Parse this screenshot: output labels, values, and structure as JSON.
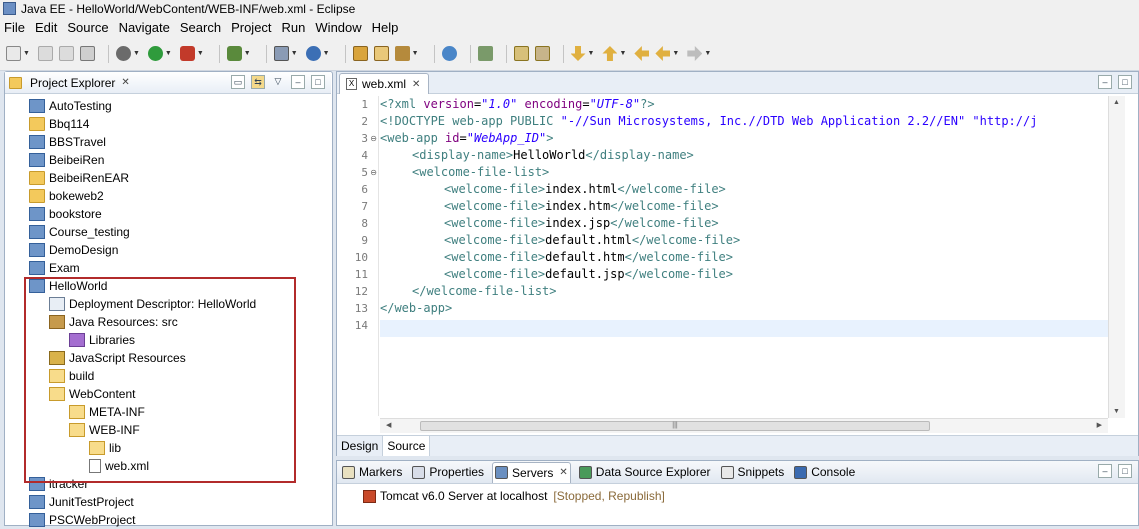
{
  "window": {
    "title": "Java EE - HelloWorld/WebContent/WEB-INF/web.xml - Eclipse"
  },
  "menu": [
    "File",
    "Edit",
    "Source",
    "Navigate",
    "Search",
    "Project",
    "Run",
    "Window",
    "Help"
  ],
  "explorer": {
    "title": "Project Explorer",
    "items": [
      {
        "label": "AutoTesting",
        "icon": "web-project-icon"
      },
      {
        "label": "Bbq114",
        "icon": "project-icon"
      },
      {
        "label": "BBSTravel",
        "icon": "web-project-icon"
      },
      {
        "label": "BeibeiRen",
        "icon": "web-project-icon"
      },
      {
        "label": "BeibeiRenEAR",
        "icon": "project-icon"
      },
      {
        "label": "bokeweb2",
        "icon": "project-icon"
      },
      {
        "label": "bookstore",
        "icon": "web-project-icon"
      },
      {
        "label": "Course_testing",
        "icon": "web-project-icon"
      },
      {
        "label": "DemoDesign",
        "icon": "web-project-icon"
      },
      {
        "label": "Exam",
        "icon": "web-project-icon"
      },
      {
        "label": "HelloWorld",
        "icon": "web-project-icon"
      },
      {
        "label": "Deployment Descriptor: HelloWorld",
        "icon": "deployment-descriptor-icon"
      },
      {
        "label": "Java Resources: src",
        "icon": "java-resources-icon"
      },
      {
        "label": "Libraries",
        "icon": "libraries-icon"
      },
      {
        "label": "JavaScript Resources",
        "icon": "javascript-resources-icon"
      },
      {
        "label": "build",
        "icon": "folder-icon"
      },
      {
        "label": "WebContent",
        "icon": "folder-icon"
      },
      {
        "label": "META-INF",
        "icon": "folder-icon"
      },
      {
        "label": "WEB-INF",
        "icon": "folder-icon"
      },
      {
        "label": "lib",
        "icon": "folder-icon"
      },
      {
        "label": "web.xml",
        "icon": "xml-file-icon"
      },
      {
        "label": "itracker",
        "icon": "web-project-icon"
      },
      {
        "label": "JunitTestProject",
        "icon": "web-project-icon"
      },
      {
        "label": "PSCWebProject",
        "icon": "web-project-icon"
      }
    ]
  },
  "editor": {
    "tab_label": "web.xml",
    "line_numbers": [
      "1",
      "2",
      "3",
      "4",
      "5",
      "6",
      "7",
      "8",
      "9",
      "10",
      "11",
      "12",
      "13",
      "14"
    ],
    "code": {
      "l1": {
        "open": "<?xml ",
        "a1": "version",
        "eq1": "=",
        "v1": "\"1.0\"",
        "sp": " ",
        "a2": "encoding",
        "eq2": "=",
        "v2": "\"UTF-8\"",
        "close": "?>"
      },
      "l2": {
        "doctype": "<!DOCTYPE web-app PUBLIC ",
        "pub": "\"-//Sun Microsystems, Inc.//DTD Web Application 2.2//EN\"",
        "sys": " \"http://j"
      },
      "l3": {
        "open": "<web-app ",
        "attr": "id",
        "eq": "=",
        "val": "\"WebApp_ID\"",
        "close": ">"
      },
      "l4": {
        "open": "<display-name>",
        "text": "HelloWorld",
        "close": "</display-name>"
      },
      "l5": {
        "open": "<welcome-file-list>"
      },
      "files": [
        "index.html",
        "index.htm",
        "index.jsp",
        "default.html",
        "default.htm",
        "default.jsp"
      ],
      "wf_open": "<welcome-file>",
      "wf_close": "</welcome-file>",
      "l12": {
        "close": "</welcome-file-list>"
      },
      "l13": {
        "close": "</web-app>"
      }
    },
    "bottom_tabs": {
      "design": "Design",
      "source": "Source"
    }
  },
  "bottom_panel": {
    "tabs": [
      "Markers",
      "Properties",
      "Servers",
      "Data Source Explorer",
      "Snippets",
      "Console"
    ],
    "active": "Servers",
    "server": {
      "name": "Tomcat v6.0 Server at localhost",
      "status": "[Stopped, Republish]"
    }
  }
}
